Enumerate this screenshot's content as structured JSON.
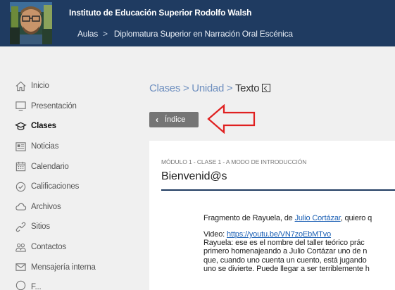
{
  "header": {
    "institution": "Instituto de Educación Superior Rodolfo Walsh",
    "breadcrumb": [
      "Aulas",
      "Diplomatura Superior en Narración Oral Escénica"
    ],
    "breadcrumb_separator": ">"
  },
  "sidebar": {
    "items": [
      {
        "label": "Inicio",
        "icon": "home-icon"
      },
      {
        "label": "Presentación",
        "icon": "monitor-icon"
      },
      {
        "label": "Clases",
        "icon": "graduation-cap-icon",
        "active": true
      },
      {
        "label": "Noticias",
        "icon": "newspaper-icon"
      },
      {
        "label": "Calendario",
        "icon": "calendar-icon"
      },
      {
        "label": "Calificaciones",
        "icon": "check-circle-icon"
      },
      {
        "label": "Archivos",
        "icon": "cloud-icon"
      },
      {
        "label": "Sitios",
        "icon": "link-icon"
      },
      {
        "label": "Contactos",
        "icon": "people-icon"
      },
      {
        "label": "Mensajería interna",
        "icon": "envelope-icon"
      },
      {
        "label": "F...",
        "icon": "forum-icon"
      }
    ]
  },
  "content": {
    "breadcrumb": {
      "part1": "Clases",
      "part2": "Unidad",
      "current": "Texto",
      "separator": ">"
    },
    "index_button": "Índice",
    "module_label": "MÓDULO 1 - CLASE 1 - A MODO DE INTRODUCCIÓN",
    "title": "Bienvenid@s",
    "fragment": {
      "prefix": "Fragmento de Rayuela, de ",
      "author_link": "Julio Cortázar",
      "suffix": ", quiero q"
    },
    "video": {
      "label": "Video:",
      "url": "https://youtu.be/VN7zoEbMTvo"
    },
    "paragraph_lines": [
      "Rayuela: ese es el nombre del taller teórico prác",
      "primero homenajeando a Julio Cortázar uno de n",
      "que, cuando uno cuenta un cuento, está jugando",
      "uno se divierte. Puede llegar a ser terriblemente h"
    ]
  },
  "colors": {
    "header": "#1f3b61",
    "annotation_arrow": "#e02020",
    "link": "#1a5fb4"
  }
}
